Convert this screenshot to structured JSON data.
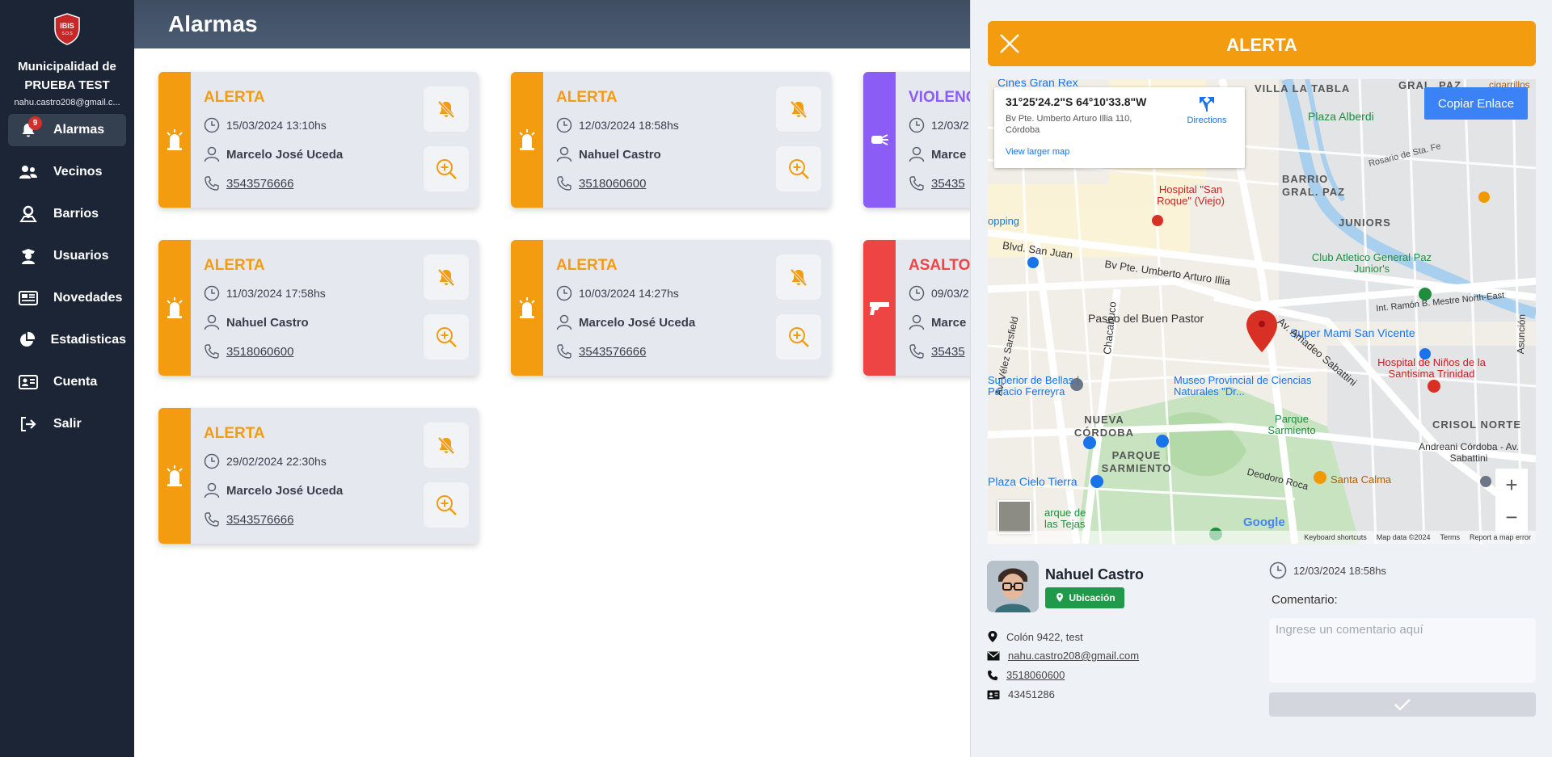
{
  "sidebar": {
    "logo_text": "IBIS",
    "logo_sub": "S.O.S",
    "municipality": "Municipalidad de PRUEBA TEST",
    "user_email": "nahu.castro208@gmail.c...",
    "alarm_count": "9",
    "items": [
      {
        "label": "Alarmas",
        "icon": "bell-icon"
      },
      {
        "label": "Vecinos",
        "icon": "users-icon"
      },
      {
        "label": "Barrios",
        "icon": "map-pin-icon"
      },
      {
        "label": "Usuarios",
        "icon": "officer-icon"
      },
      {
        "label": "Novedades",
        "icon": "newspaper-icon"
      },
      {
        "label": "Estadisticas",
        "icon": "pie-chart-icon"
      },
      {
        "label": "Cuenta",
        "icon": "id-card-icon"
      },
      {
        "label": "Salir",
        "icon": "logout-icon"
      }
    ]
  },
  "header": {
    "title": "Alarmas"
  },
  "colors": {
    "alerta": "#f39c10",
    "violencia": "#8b5cf6",
    "asalto": "#ef4444"
  },
  "cards": [
    {
      "type": "ALERTA",
      "datetime": "15/03/2024 13:10hs",
      "name": "Marcelo José Uceda",
      "phone": "3543576666"
    },
    {
      "type": "ALERTA",
      "datetime": "12/03/2024 18:58hs",
      "name": "Nahuel Castro",
      "phone": "3518060600"
    },
    {
      "type": "VIOLENC",
      "datetime": "12/03/2",
      "name": "Marce",
      "phone": "35435"
    },
    {
      "type": "ALERTA",
      "datetime": "11/03/2024 17:58hs",
      "name": "Nahuel Castro",
      "phone": "3518060600"
    },
    {
      "type": "ALERTA",
      "datetime": "10/03/2024 14:27hs",
      "name": "Marcelo José Uceda",
      "phone": "3543576666"
    },
    {
      "type": "ASALTO",
      "datetime": "09/03/2",
      "name": "Marce",
      "phone": "35435"
    },
    {
      "type": "ALERTA",
      "datetime": "29/02/2024 22:30hs",
      "name": "Marcelo José Uceda",
      "phone": "3543576666"
    }
  ],
  "panel": {
    "title": "ALERTA",
    "map": {
      "coords": "31°25'24.2\"S 64°10'33.8\"W",
      "address": "Bv Pte. Umberto Arturo Illia 110, Córdoba",
      "directions": "Directions",
      "larger_map": "View larger map",
      "copy_link": "Copiar Enlace",
      "labels": {
        "cines": "Cines Gran Rex",
        "villa": "VILLA LA TABLA",
        "gral_paz_top": "GRAL. PAZ",
        "cigarrillos": "cigarrillos",
        "plaza_alberdi": "Plaza Alberdi",
        "rosario": "Rosario de Sta. Fe",
        "barrio": "BARRIO",
        "gral_paz": "GRAL. PAZ",
        "juniors": "JUNIORS",
        "hospital_san_roque": "Hospital \"San Roque\" (Viejo)",
        "opping": "opping",
        "blvd_san_juan": "Blvd. San Juan",
        "illia": "Bv Pte. Umberto Arturo Illia",
        "club_atletico": "Club Atletico General Paz Junior's",
        "mestre": "Int. Ramón B. Mestre North-East",
        "paseo": "Paseo del Buen Pastor",
        "super_mami": "Super Mami San Vicente",
        "sabattini": "Av. Amadeo Sabattini",
        "hospital_ninos": "Hospital de Niños de la Santisima Trinidad",
        "superior": "Superior de Bellas | Palacio Ferreyra",
        "museo": "Museo Provincial de Ciencias Naturales \"Dr...",
        "parque_sarmiento": "Parque Sarmiento",
        "nueva_cordoba": "NUEVA CÓRDOBA",
        "parque_sarm_barrio": "PARQUE SARMIENTO",
        "crisol": "CRISOL NORTE",
        "andreani": "Andreani Córdoba - Av. Sabattini",
        "plaza_cielo": "Plaza Cielo Tierra",
        "arque": "arque de las Tejas",
        "deodoro": "Deodoro Roca",
        "santa_calma": "Santa Calma",
        "chacabuco": "Chacabuco",
        "velez": "Av. Vélez Sarsfield",
        "asuncion": "Asunción"
      },
      "footer": [
        "Keyboard shortcuts",
        "Map data ©2024",
        "Terms",
        "Report a map error"
      ],
      "google": "Google"
    },
    "person": {
      "name": "Nahuel Castro",
      "location_button": "Ubicación",
      "address": "Colón 9422, test",
      "email": "nahu.castro208@gmail.com",
      "phone": "3518060600",
      "dni": "43451286"
    },
    "timestamp": "12/03/2024 18:58hs",
    "comment_label": "Comentario:",
    "comment_placeholder": "Ingrese un comentario aquí"
  }
}
